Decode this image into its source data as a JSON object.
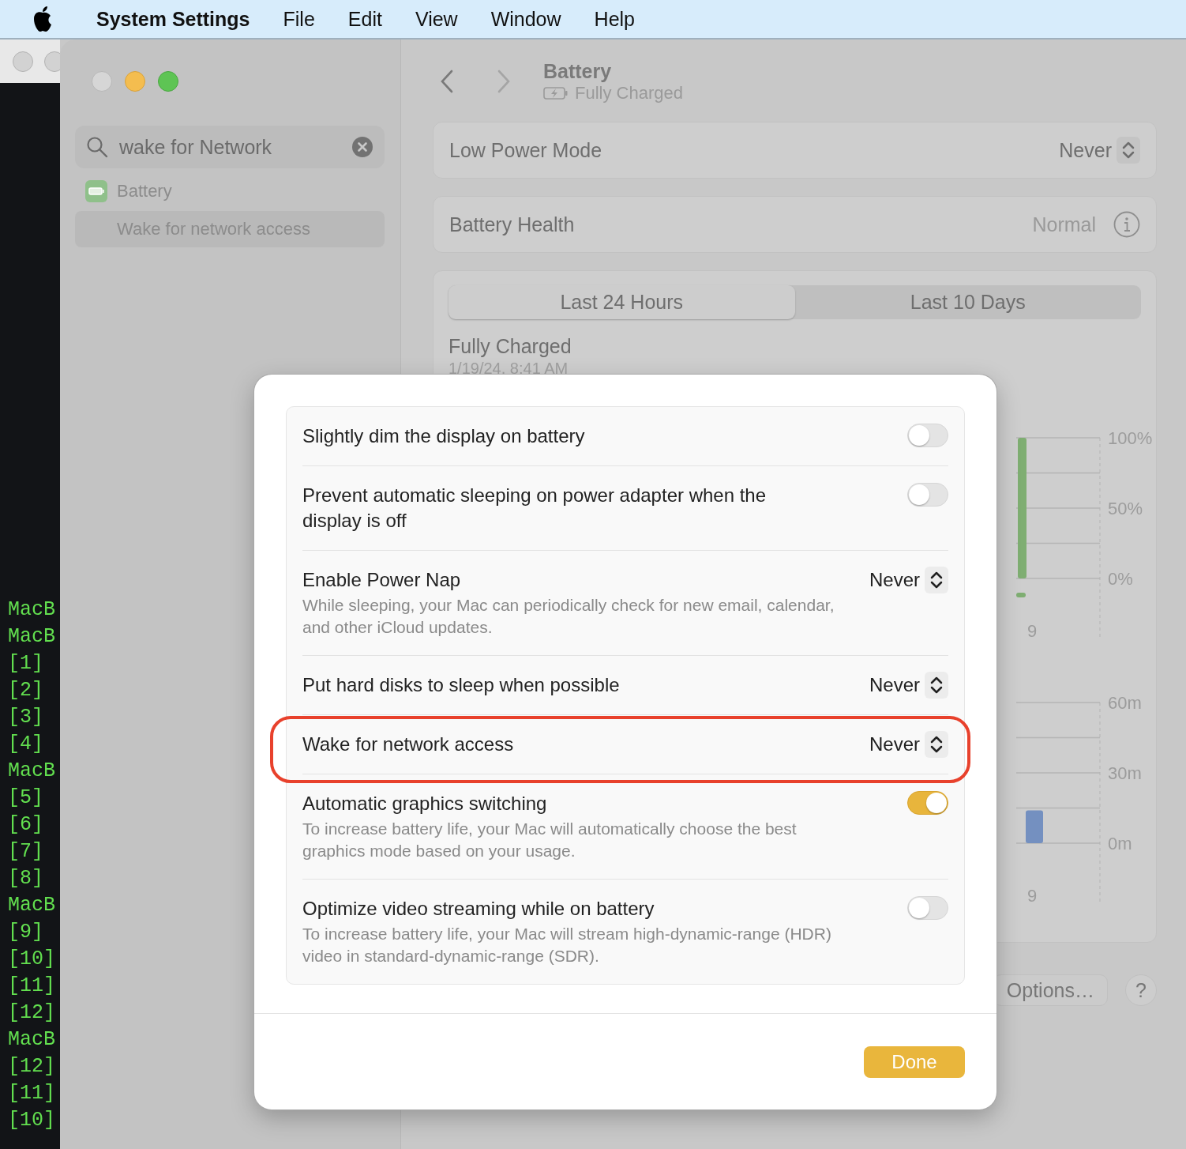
{
  "menu_bar": {
    "app_name": "System Settings",
    "items": [
      "File",
      "Edit",
      "View",
      "Window",
      "Help"
    ]
  },
  "terminal": {
    "lines": [
      "MacB",
      "MacB",
      "[1]",
      "[2]",
      "[3]",
      "[4]",
      "MacB",
      "[5]",
      "[6]",
      "[7]",
      "[8]",
      "MacB",
      "[9]",
      "[10]",
      "[11]",
      "[12]",
      "MacB",
      "[12]",
      "[11]",
      "[10]"
    ]
  },
  "sidebar": {
    "search": {
      "value": "wake for Network"
    },
    "results": [
      {
        "label": "Battery",
        "kind": "category",
        "selected": false
      },
      {
        "label": "Wake for network access",
        "kind": "setting",
        "selected": true
      }
    ]
  },
  "header": {
    "title": "Battery",
    "subtitle": "Fully Charged"
  },
  "settings": [
    {
      "label": "Low Power Mode",
      "kind": "popup",
      "value": "Never"
    },
    {
      "label": "Battery Health",
      "kind": "info",
      "value": "Normal"
    }
  ],
  "usage": {
    "tabs": [
      {
        "label": "Last 24 Hours",
        "selected": true
      },
      {
        "label": "Last 10 Days",
        "selected": false
      }
    ],
    "status": "Fully Charged",
    "date": "1/19/24, 8:41 AM",
    "charts": [
      {
        "chart_data": {
          "type": "bar",
          "categories": [
            "9"
          ],
          "series": [
            {
              "color": "#7fae72",
              "values": [
                100
              ]
            }
          ],
          "ylim": [
            0,
            100
          ],
          "yticks": [
            {
              "value": 100,
              "label": "100%"
            },
            {
              "value": 50,
              "label": "50%"
            },
            {
              "value": 0,
              "label": "0%"
            }
          ]
        }
      },
      {
        "chart_data": {
          "type": "bar",
          "categories": [
            "9"
          ],
          "series": [
            {
              "color": "#7490c0",
              "values": [
                14
              ]
            }
          ],
          "ylim": [
            0,
            60
          ],
          "yticks": [
            {
              "value": 60,
              "label": "60m"
            },
            {
              "value": 30,
              "label": "30m"
            },
            {
              "value": 0,
              "label": "0m"
            }
          ]
        }
      }
    ]
  },
  "buttons": [
    {
      "label": "Options…",
      "kind": "text"
    },
    {
      "label": "?",
      "kind": "help"
    }
  ],
  "dialog": {
    "rows": [
      {
        "kind": "toggle",
        "title": "Slightly dim the display on battery",
        "on": false,
        "highlighted": false
      },
      {
        "kind": "toggle",
        "title": "Prevent automatic sleeping on power adapter when the display is off",
        "on": false,
        "highlighted": false
      },
      {
        "kind": "popup",
        "title": "Enable Power Nap",
        "description": "While sleeping, your Mac can periodically check for new email, calendar, and other iCloud updates.",
        "value": "Never",
        "highlighted": false
      },
      {
        "kind": "popup",
        "title": "Put hard disks to sleep when possible",
        "value": "Never",
        "highlighted": false
      },
      {
        "kind": "popup",
        "title": "Wake for network access",
        "value": "Never",
        "highlighted": true
      },
      {
        "kind": "toggle",
        "title": "Automatic graphics switching",
        "description": "To increase battery life, your Mac will automatically choose the best graphics mode based on your usage.",
        "on": true,
        "highlighted": false
      },
      {
        "kind": "toggle",
        "title": "Optimize video streaming while on battery",
        "description": "To increase battery life, your Mac will stream high-dynamic-range (HDR) video in standard-dynamic-range (SDR).",
        "on": false,
        "highlighted": false
      }
    ],
    "done_button": "Done"
  }
}
